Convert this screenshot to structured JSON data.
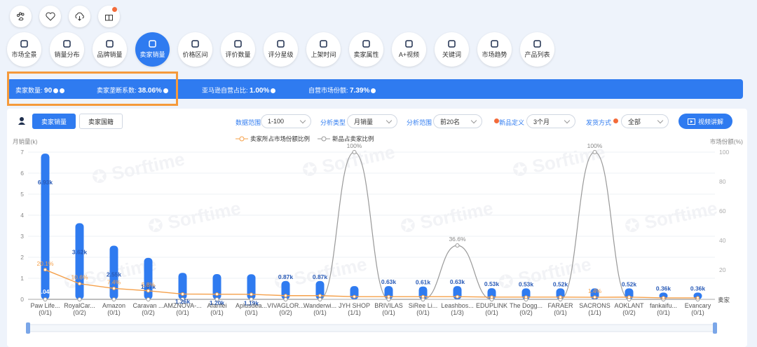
{
  "top_icons": [
    "paw-icon",
    "heart-icon",
    "cloud-download-icon",
    "gift-icon"
  ],
  "nav": [
    {
      "label": "市场全景",
      "icon": "dashboard-icon"
    },
    {
      "label": "销量分布",
      "icon": "bar-chart-icon"
    },
    {
      "label": "品牌销量",
      "icon": "brand-icon"
    },
    {
      "label": "卖家销量",
      "icon": "seller-icon",
      "active": true
    },
    {
      "label": "价格区间",
      "icon": "price-icon"
    },
    {
      "label": "评价数量",
      "icon": "review-icon"
    },
    {
      "label": "评分星级",
      "icon": "star-icon"
    },
    {
      "label": "上架时间",
      "icon": "calendar-icon"
    },
    {
      "label": "卖家属性",
      "icon": "attribute-icon"
    },
    {
      "label": "A+视频",
      "icon": "video-icon"
    },
    {
      "label": "关键词",
      "icon": "lock-icon"
    },
    {
      "label": "市场趋势",
      "icon": "trend-icon"
    },
    {
      "label": "产品列表",
      "icon": "list-icon"
    }
  ],
  "stats": {
    "seller_count_label": "卖家数量:",
    "seller_count": "90",
    "concentration_label": "卖家垄断系数:",
    "concentration": "38.06%",
    "amazon_label": "亚马逊自营占比:",
    "amazon": "1.00%",
    "self_label": "自营市场份额:",
    "self": "7.39%"
  },
  "toolbar": {
    "tab_sales": "卖家销量",
    "tab_country": "卖家国籍",
    "range_label": "数据范围",
    "range_value": "1-100",
    "type_label": "分析类型",
    "type_value": "月销量",
    "scope_label": "分析范围",
    "scope_value": "前20名",
    "newdef_label": "新品定义",
    "newdef_value": "3个月",
    "ship_label": "发货方式",
    "ship_value": "全部",
    "video_label": "视频讲解"
  },
  "chart_data": {
    "type": "bar",
    "ylabel_left": "月销量(k)",
    "ylabel_right": "市场份额(%)",
    "ylim_left": [
      0,
      7
    ],
    "ylim_right": [
      0,
      100
    ],
    "left_ticks": [
      "0",
      "1",
      "2",
      "3",
      "4",
      "5",
      "6",
      "7"
    ],
    "right_ticks": [
      "0",
      "20",
      "40",
      "60",
      "80",
      "100"
    ],
    "x_axis_end_label": "卖家",
    "categories": [
      "Paw Life...",
      "RoyalCar...",
      "Amazon",
      "Caravan ...",
      "AMZNOVA-...",
      "Afanfei",
      "Aplusdea...",
      "VIVAGLOR...",
      "Wanderwi...",
      "JYH SHOP",
      "BRIVILAS",
      "SiRee Li...",
      "Leashbos...",
      "EDUPLINK",
      "The Dogg...",
      "FARAER",
      "SACRONS",
      "AOKLANT",
      "fankaifu...",
      "Evancary"
    ],
    "subcategories": [
      "(0/1)",
      "(0/2)",
      "(0/1)",
      "(0/2)",
      "(0/1)",
      "(0/1)",
      "(0/1)",
      "(0/2)",
      "(0/1)",
      "(1/1)",
      "(0/1)",
      "(0/1)",
      "(1/3)",
      "(0/1)",
      "(0/2)",
      "(0/1)",
      "(1/1)",
      "(0/2)",
      "(0/1)",
      "(0/1)"
    ],
    "series": [
      {
        "name": "月销量",
        "values": [
          6.93,
          3.62,
          2.55,
          1.97,
          1.26,
          1.2,
          1.19,
          0.87,
          0.87,
          0.63,
          0.63,
          0.61,
          0.63,
          0.53,
          0.52,
          0.52,
          0.52,
          0.52,
          0.32,
          0.32
        ],
        "color": "#2f7bf0"
      },
      {
        "name": "卖家所占市场份额比例",
        "values": [
          20.1,
          10.6,
          7.4,
          5.8,
          3.6,
          3.5,
          3.4,
          2.5,
          2.5,
          1.8,
          1.8,
          1.8,
          1.8,
          1.5,
          1.5,
          1.5,
          1.4,
          1.5,
          1.0,
          1.0
        ],
        "color": "#f5a04a"
      },
      {
        "name": "新品占卖家比例",
        "values": [
          0,
          0,
          0,
          0,
          0,
          0,
          0,
          0,
          0,
          100,
          0,
          0,
          36.6,
          0,
          0,
          0,
          100,
          0,
          0,
          0
        ],
        "color": "#999999"
      }
    ],
    "bar_labels": [
      "6.93k",
      "3.62k",
      "2.55k",
      "1.97k",
      "1.26k",
      "1.20k",
      "1.19k",
      "0.87k",
      "0.87k",
      "",
      "0.63k",
      "0.61k",
      "0.63k",
      "0.53k",
      "0.53k",
      "0.52k",
      "",
      "0.52k",
      "0.36k",
      "0.36k"
    ],
    "share_labels": [
      "20.1%",
      "10.6%",
      "7.4%",
      "5.8%",
      "",
      "",
      "",
      "",
      "",
      "",
      "",
      "",
      "",
      "",
      "",
      "",
      "1.4%",
      "",
      "",
      ""
    ],
    "new_labels": [
      "",
      "",
      "",
      "",
      "",
      "",
      "",
      "",
      "",
      "100%",
      "",
      "",
      "36.6%",
      "",
      "",
      "",
      "100%",
      "",
      "",
      ""
    ],
    "inner_labels": [
      "0.04k",
      "",
      "",
      "",
      "",
      "",
      "",
      "",
      "",
      "",
      "",
      "",
      "",
      "",
      "",
      "",
      "",
      "",
      "",
      ""
    ],
    "grid": true,
    "legend": "top-center"
  }
}
